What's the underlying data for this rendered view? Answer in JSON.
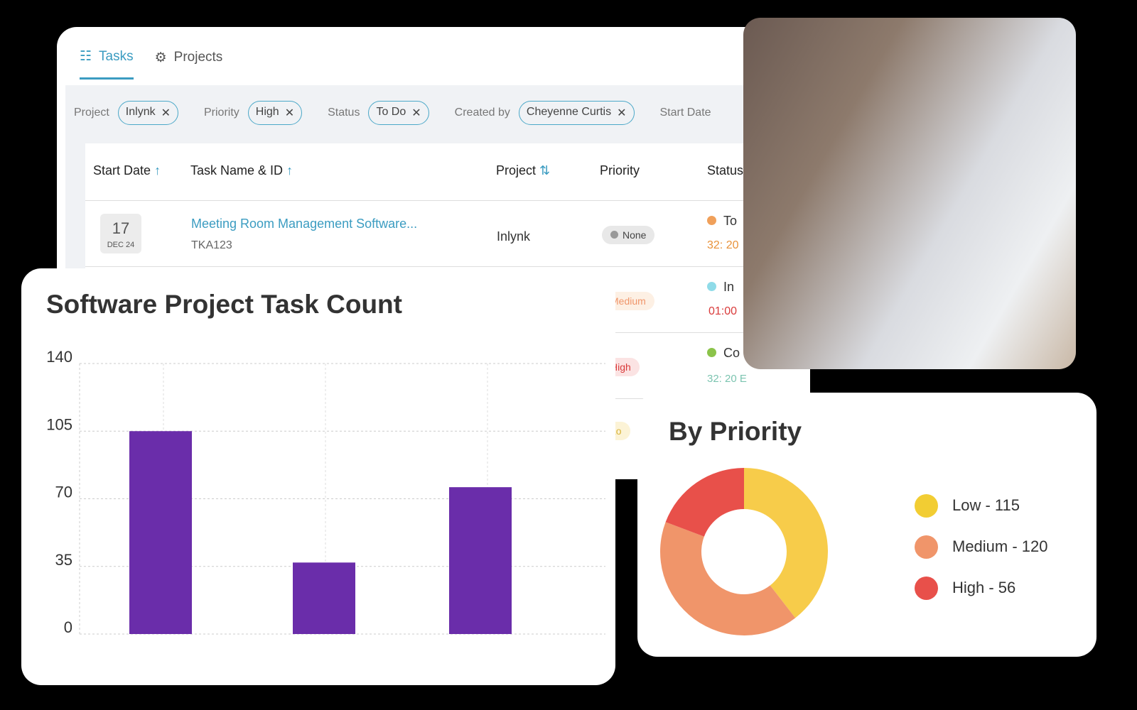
{
  "tabs": [
    {
      "label": "Tasks",
      "icon": "checklist-icon"
    },
    {
      "label": "Projects",
      "icon": "clipboard-gear-icon"
    }
  ],
  "filters": [
    {
      "label": "Project",
      "value": "Inlynk"
    },
    {
      "label": "Priority",
      "value": "High"
    },
    {
      "label": "Status",
      "value": "To Do"
    },
    {
      "label": "Created by",
      "value": "Cheyenne Curtis"
    },
    {
      "label": "Start Date",
      "value": ""
    }
  ],
  "table": {
    "headers": [
      "Start Date",
      "Task Name & ID",
      "Project",
      "Priority",
      "Status"
    ],
    "rows": [
      {
        "day": "17",
        "month": "DEC 24",
        "task": "Meeting Room Management Software...",
        "id": "TKA123",
        "project": "Inlynk",
        "priority": "None",
        "status": "To",
        "time": "32: 20"
      },
      {
        "priority": "Medium",
        "status": "In",
        "time": "01:00"
      },
      {
        "priority": "High",
        "status": "Co",
        "time": "32: 20 E"
      },
      {
        "priority": "Lo"
      }
    ]
  },
  "colors": {
    "accent": "#3b9cc1",
    "bar": "#6a2daa",
    "low": "#f7cc4a",
    "medium": "#f0956a",
    "high": "#e8504a"
  },
  "chart_data": [
    {
      "type": "bar",
      "title": "Software Project Task Count",
      "categories": [
        "",
        "",
        ""
      ],
      "values": [
        105,
        37,
        76
      ],
      "ylim": [
        0,
        140
      ],
      "yticks": [
        0,
        35,
        70,
        105,
        140
      ],
      "grid": true
    },
    {
      "type": "pie",
      "title": "By Priority",
      "donut": true,
      "labels": [
        "Low",
        "Medium",
        "High"
      ],
      "values": [
        115,
        120,
        56
      ],
      "legend": [
        "Low - 115",
        "Medium - 120",
        "High - 56"
      ],
      "legend_position": "right"
    }
  ]
}
